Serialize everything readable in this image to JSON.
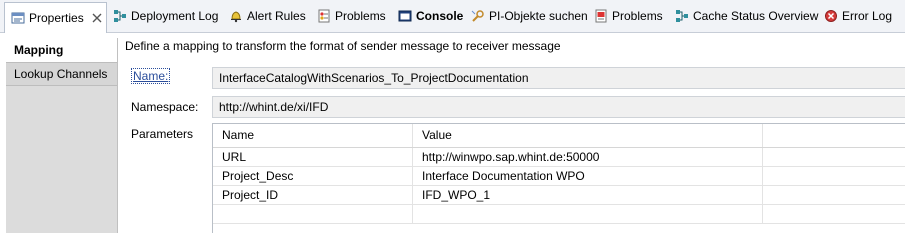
{
  "tabs": [
    {
      "id": "properties",
      "label": "Properties",
      "icon": "properties-icon",
      "active": true,
      "bold": false
    },
    {
      "id": "deployment-log",
      "label": "Deployment Log",
      "icon": "deployment-log-icon",
      "bold": false
    },
    {
      "id": "alert-rules",
      "label": "Alert Rules",
      "icon": "alert-bell-icon",
      "bold": false
    },
    {
      "id": "problems-1",
      "label": "Problems",
      "icon": "problems-icon",
      "bold": false
    },
    {
      "id": "console",
      "label": "Console",
      "icon": "console-icon",
      "bold": true
    },
    {
      "id": "pi-objekte",
      "label": "PI-Objekte suchen",
      "icon": "search-objects-icon",
      "bold": false
    },
    {
      "id": "problems-2",
      "label": "Problems",
      "icon": "problems-icon",
      "bold": false
    },
    {
      "id": "cache-status",
      "label": "Cache Status Overview",
      "icon": "cache-status-icon",
      "bold": false
    },
    {
      "id": "error-log",
      "label": "Error Log",
      "icon": "error-log-icon",
      "bold": false
    }
  ],
  "close_icon": "close-icon",
  "leftnav": {
    "items": [
      {
        "label": "Mapping",
        "active": true
      },
      {
        "label": "Lookup Channels",
        "active": false
      }
    ]
  },
  "main": {
    "description": "Define a mapping to transform the format of sender message to receiver message",
    "name_label": "Name:",
    "name_value": "InterfaceCatalogWithScenarios_To_ProjectDocumentation",
    "namespace_label": "Namespace:",
    "namespace_value": "http://whint.de/xi/IFD",
    "parameters_label": "Parameters",
    "table": {
      "headers": [
        "Name",
        "Value",
        ""
      ],
      "rows": [
        [
          "URL",
          "http://winwpo.sap.whint.de:50000",
          ""
        ],
        [
          "Project_Desc",
          "Interface Documentation WPO",
          ""
        ],
        [
          "Project_ID",
          "IFD_WPO_1",
          ""
        ]
      ]
    }
  },
  "colors": {
    "tabbar_bg": "#f1f3f7",
    "leftnav_bg": "#dcdcdc",
    "field_bg": "#f0f0f0",
    "link": "#2b4e9b"
  }
}
